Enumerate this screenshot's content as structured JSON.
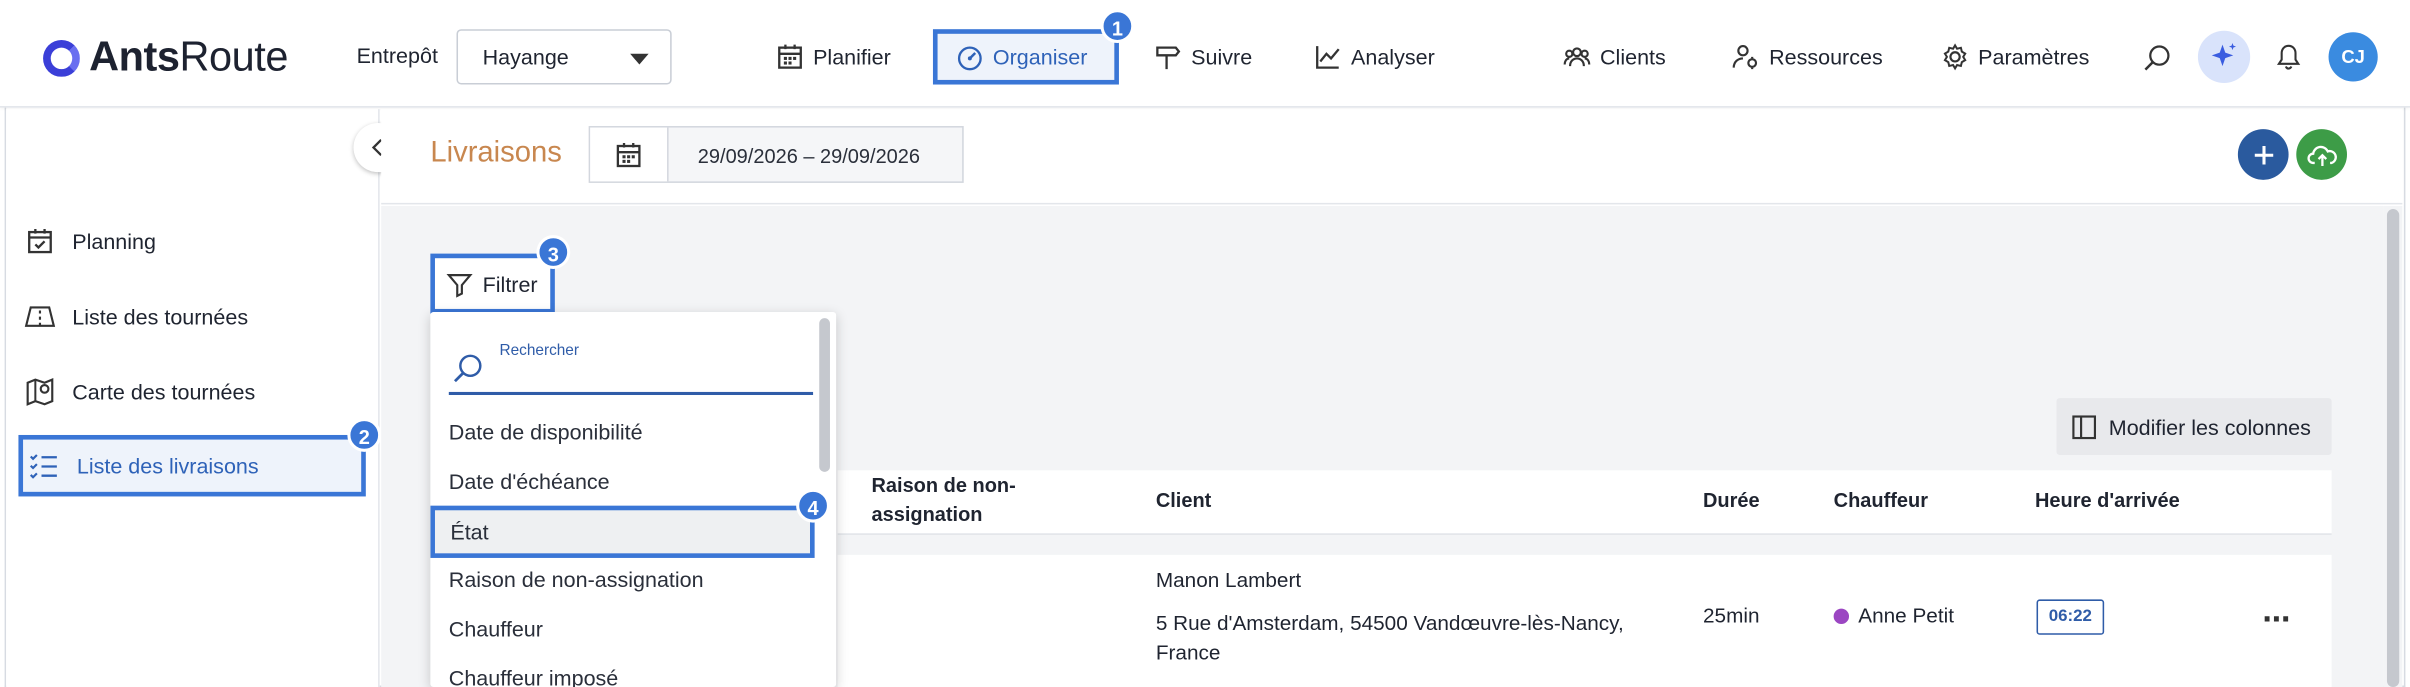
{
  "brand": {
    "name_bold": "Ants",
    "name_light": "Route"
  },
  "warehouse": {
    "label": "Entrepôt",
    "value": "Hayange"
  },
  "nav": {
    "planifier": "Planifier",
    "organiser": "Organiser",
    "suivre": "Suivre",
    "analyser": "Analyser",
    "clients": "Clients",
    "ressources": "Ressources",
    "parametres": "Paramètres"
  },
  "user": {
    "initials": "CJ"
  },
  "badges": {
    "b1": "1",
    "b2": "2",
    "b3": "3",
    "b4": "4"
  },
  "sidebar": {
    "items": [
      {
        "label": "Planning"
      },
      {
        "label": "Liste des tournées"
      },
      {
        "label": "Carte des tournées"
      },
      {
        "label": "Liste des livraisons"
      }
    ]
  },
  "page": {
    "title": "Livraisons",
    "date_range": "29/09/2026 – 29/09/2026"
  },
  "filter": {
    "button_label": "Filtrer",
    "search_placeholder": "Rechercher",
    "options": [
      "Date de disponibilité",
      "Date d'échéance",
      "État",
      "Raison de non-assignation",
      "Chauffeur",
      "Chauffeur imposé"
    ],
    "selected": "État"
  },
  "columns_button": "Modifier les colonnes",
  "table": {
    "headers": {
      "raison_line1": "Raison de non-",
      "raison_line2": "assignation",
      "client": "Client",
      "duree": "Durée",
      "chauffeur": "Chauffeur",
      "heure": "Heure d'arrivée"
    },
    "rows": [
      {
        "client_name": "Manon Lambert",
        "address_line1": "5 Rue d'Amsterdam, 54500 Vandœuvre-lès-Nancy,",
        "address_line2": "France",
        "duration": "25min",
        "driver": "Anne Petit",
        "arrival": "06:22",
        "driver_color": "#9b46c2",
        "more": "⋯"
      }
    ]
  },
  "colors": {
    "accent": "#3a76d6",
    "title": "#c8874f",
    "fab_add": "#2a5a9e",
    "fab_cloud": "#3d9c47"
  }
}
